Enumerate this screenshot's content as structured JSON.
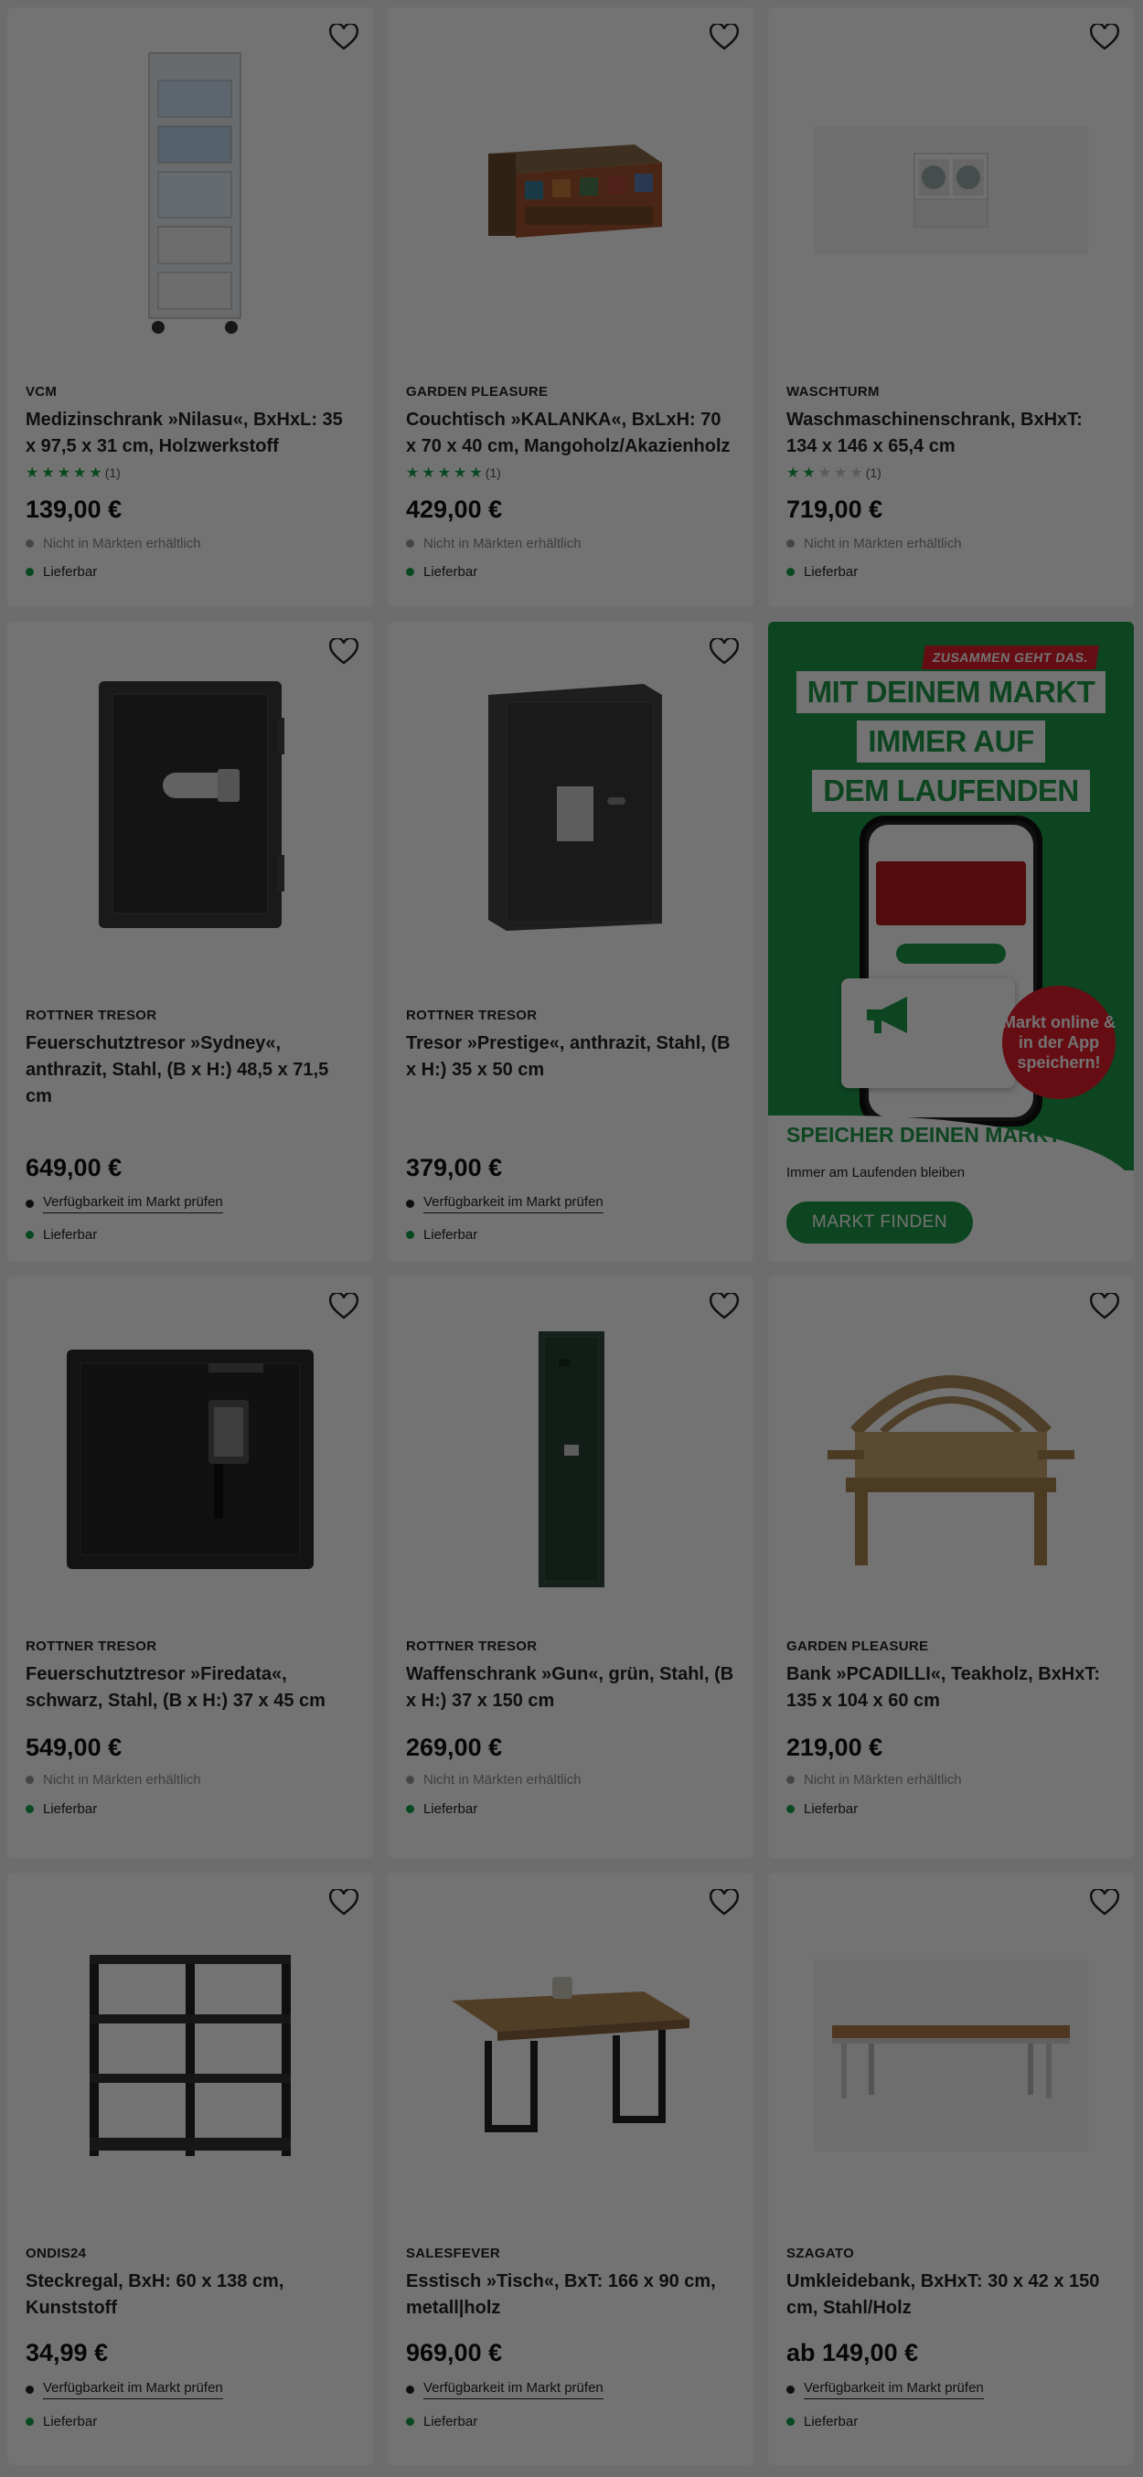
{
  "labels": {
    "not_in_store": "Nicht in Märkten erhältlich",
    "check_store": "Verfügbarkeit im Markt prüfen",
    "deliverable": "Lieferbar"
  },
  "products": [
    {
      "brand": "VCM",
      "title": "Medizinschrank »Nilasu«, BxHxL: 35 x 97,5 x 31 cm, Holzwerkstoff",
      "rating": 5,
      "reviews": "(1)",
      "price": "139,00 €"
    },
    {
      "brand": "GARDEN PLEASURE",
      "title": "Couchtisch »KALANKA«, BxLxH: 70 x 70 x 40 cm, Mangoholz/Akazienholz",
      "rating": 5,
      "reviews": "(1)",
      "price": "429,00 €"
    },
    {
      "brand": "WASCHTURM",
      "title": "Waschmaschinenschrank, BxHxT: 134 x 146 x 65,4 cm",
      "rating": 2,
      "reviews": "(1)",
      "price": "719,00 €"
    },
    {
      "brand": "ROTTNER TRESOR",
      "title": "Feuerschutztresor »Sydney«, anthrazit, Stahl, (B x H:) 48,5 x 71,5 cm",
      "price": "649,00 €"
    },
    {
      "brand": "ROTTNER TRESOR",
      "title": "Tresor »Prestige«, anthrazit, Stahl, (B x H:) 35 x 50 cm",
      "price": "379,00 €"
    },
    {
      "brand": "ROTTNER TRESOR",
      "title": "Feuerschutztresor »Firedata«, schwarz, Stahl, (B x H:) 37 x 45 cm",
      "price": "549,00 €"
    },
    {
      "brand": "ROTTNER TRESOR",
      "title": "Waffenschrank »Gun«, grün, Stahl, (B x H:) 37 x 150 cm",
      "price": "269,00 €"
    },
    {
      "brand": "GARDEN PLEASURE",
      "title": "Bank »PCADILLI«, Teakholz, BxHxT: 135 x 104 x 60 cm",
      "price": "219,00 €"
    },
    {
      "brand": "ONDIS24",
      "title": "Steckregal, BxH: 60 x 138 cm, Kunststoff",
      "price": "34,99 €"
    },
    {
      "brand": "SALESFEVER",
      "title": "Esstisch »Tisch«, BxT: 166 x 90 cm, metall|holz",
      "price": "969,00 €"
    },
    {
      "brand": "SZAGATO",
      "title": "Umkleidebank, BxHxT: 30 x 42 x 150 cm, Stahl/Holz",
      "price": "ab 149,00 €"
    }
  ],
  "promo": {
    "badge": "ZUSAMMEN GEHT DAS.",
    "line1": "MIT DEINEM MARKT",
    "line2": "IMMER AUF",
    "line3": "DEM LAUFENDEN",
    "circle": "Markt online & in der App speichern!",
    "heading": "SPEICHER DEINEN MARKT",
    "desc": "Immer am Laufenden bleiben",
    "button": "MARKT FINDEN"
  },
  "colors": {
    "accent_green": "#1f9a4a",
    "promo_red": "#e11d2c",
    "overlay": "rgba(0,0,0,0.55)"
  }
}
